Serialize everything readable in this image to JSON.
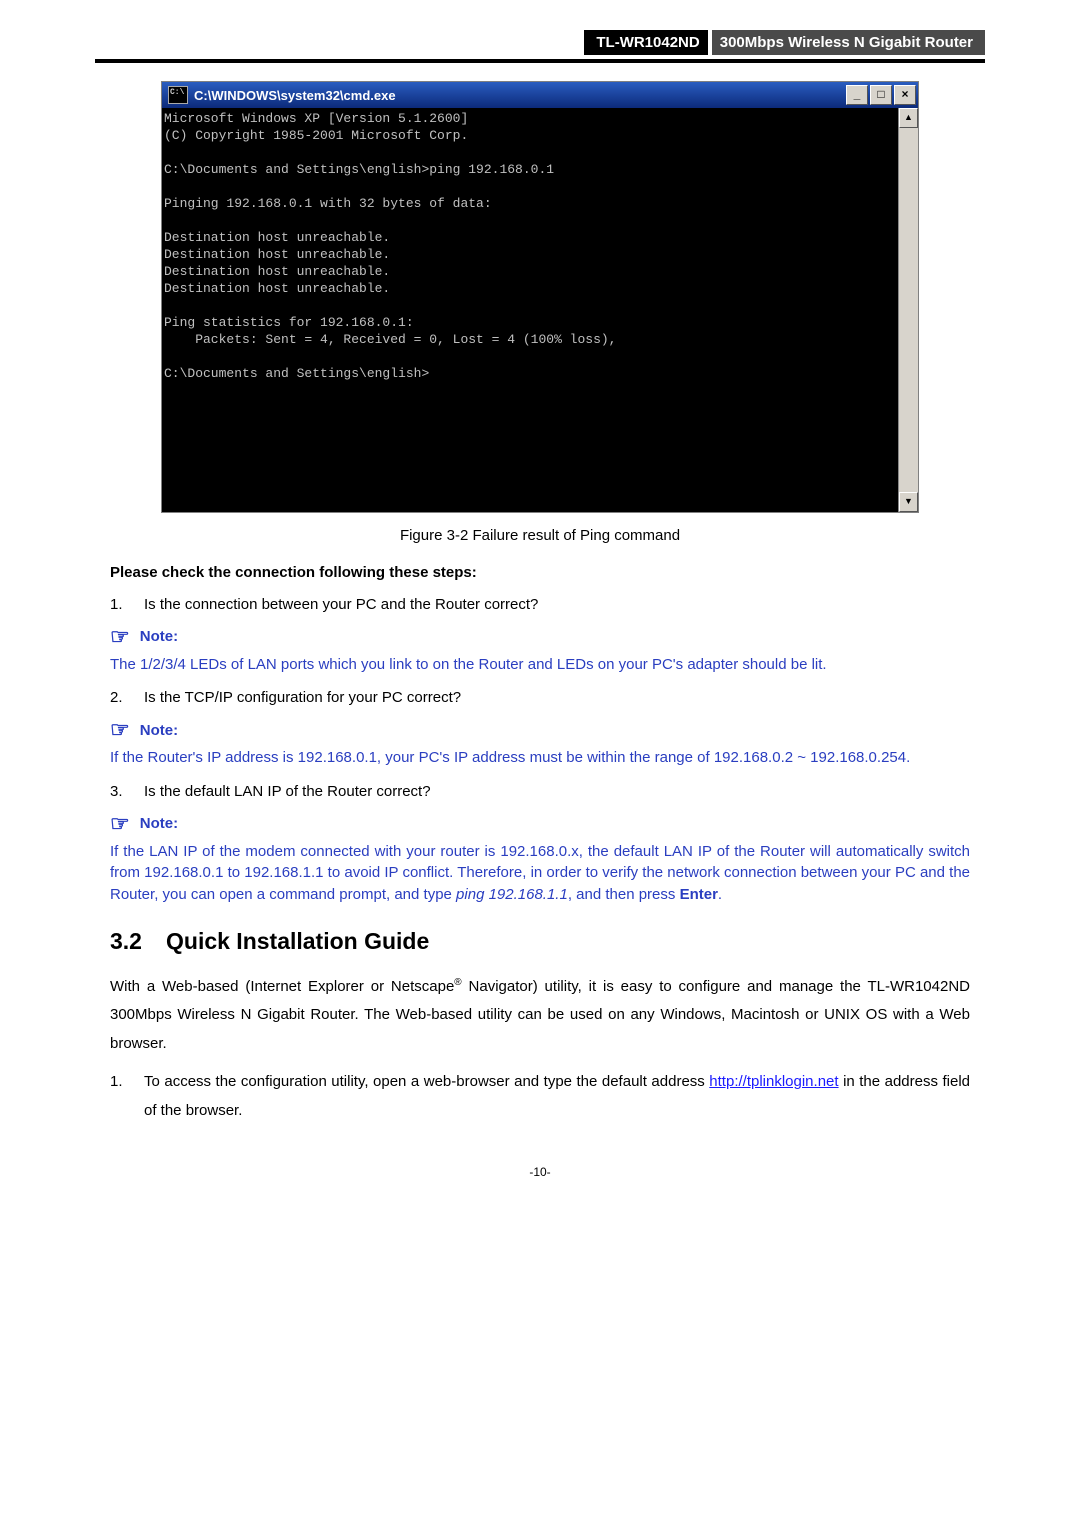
{
  "header": {
    "model": "TL-WR1042ND",
    "desc": "300Mbps Wireless N Gigabit Router"
  },
  "cmd": {
    "title": "C:\\WINDOWS\\system32\\cmd.exe",
    "btn_min": "_",
    "btn_max": "□",
    "btn_close": "×",
    "sb_up": "▲",
    "sb_down": "▼",
    "lines": "Microsoft Windows XP [Version 5.1.2600]\n(C) Copyright 1985-2001 Microsoft Corp.\n\nC:\\Documents and Settings\\english>ping 192.168.0.1\n\nPinging 192.168.0.1 with 32 bytes of data:\n\nDestination host unreachable.\nDestination host unreachable.\nDestination host unreachable.\nDestination host unreachable.\n\nPing statistics for 192.168.0.1:\n    Packets: Sent = 4, Received = 0, Lost = 4 (100% loss),\n\nC:\\Documents and Settings\\english>"
  },
  "figure_caption": "Figure 3-2   Failure result of Ping command",
  "check_heading": "Please check the connection following these steps:",
  "steps": {
    "s1_num": "1.",
    "s1": "Is the connection between your PC and the Router correct?",
    "s2_num": "2.",
    "s2": "Is the TCP/IP configuration for your PC correct?",
    "s3_num": "3.",
    "s3": "Is the default LAN IP of the Router correct?"
  },
  "notes": {
    "label": "Note:",
    "n1": "The 1/2/3/4 LEDs of LAN ports which you link to on the Router and LEDs on your PC's adapter should be lit.",
    "n2": "If the Router's IP address is 192.168.0.1, your PC's IP address must be within the range of 192.168.0.2 ~ 192.168.0.254.",
    "n3_a": "If the LAN IP of the modem connected with your router is 192.168.0.x, the default LAN IP of the Router will automatically switch from 192.168.0.1 to 192.168.1.1 to avoid IP conflict. Therefore, in order to verify the network connection between your PC and the Router, you can open a command prompt, and type ",
    "n3_i": "ping 192.168.1.1",
    "n3_b": ", and then press ",
    "n3_bold": "Enter",
    "n3_c": "."
  },
  "section": {
    "num": "3.2",
    "title": "Quick Installation Guide"
  },
  "body": {
    "p1_a": "With a Web-based (Internet Explorer or Netscape",
    "p1_sup": "®",
    "p1_b": " Navigator) utility, it is easy to configure and manage the TL-WR1042ND 300Mbps Wireless N Gigabit Router. The Web-based utility can be used on any Windows, Macintosh or UNIX OS with a Web browser.",
    "l1_num": "1.",
    "l1_a": "To access the configuration utility, open a web-browser and type the default address ",
    "l1_link": "http://tplinklogin.net",
    "l1_b": " in the address field of the browser."
  },
  "pagenum": "-10-"
}
